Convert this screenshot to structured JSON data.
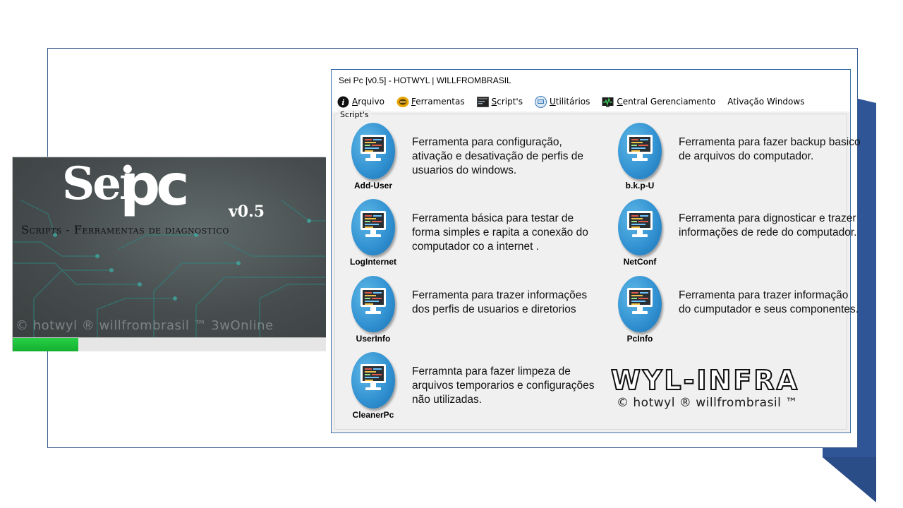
{
  "splash": {
    "logo_sei": "Sei",
    "logo_pc": "pc",
    "version": "v0.5",
    "subtitle": "Scripts - Ferramentas de diagnostico",
    "copyright": "© hotwyl ® willfrombrasil ™ 3wOnline",
    "progress": 0.21
  },
  "window": {
    "title": "Sei Pc [v0.5] - HOTWYL | WILLFROMBRASIL",
    "menu": [
      {
        "label": "Arquivo",
        "icon": "info-icon"
      },
      {
        "label": "Ferramentas",
        "icon": "tools-icon"
      },
      {
        "label": "Script's",
        "icon": "terminal-icon"
      },
      {
        "label": "Utilitários",
        "icon": "utility-icon"
      },
      {
        "label": "Central Gerenciamento",
        "icon": "monitor-icon"
      },
      {
        "label": "Ativação Windows",
        "icon": ""
      }
    ],
    "group_label": "Script's"
  },
  "tools": [
    {
      "name": "Add-User",
      "desc": "Ferramenta para configuração, ativação e desativação de perfis de usuarios do windows."
    },
    {
      "name": "b.k.p-U",
      "desc": "Ferramenta para fazer backup basico de arquivos do computador."
    },
    {
      "name": "LogInternet",
      "desc": "Ferramenta básica para testar de forma simples e rapita a conexão do computador co a internet ."
    },
    {
      "name": "NetConf",
      "desc": "Ferramenta para dignosticar e trazer informações de rede do computador."
    },
    {
      "name": "UserInfo",
      "desc": "Ferramenta para trazer informações dos perfis de usuarios e diretorios"
    },
    {
      "name": "PcInfo",
      "desc": "Ferramenta para trazer informação do cumputador e seus componentes."
    },
    {
      "name": "CleanerPc",
      "desc": "Ferramnta para fazer limpeza de arquivos temporarios e configurações não utilizadas."
    }
  ],
  "brand": {
    "title": "WYL-INFRA",
    "copyright": "© hotwyl ® willfrombrasil ™"
  },
  "colors": {
    "frame": "#3b5f8f",
    "deco_shape": "#2f5597",
    "progress": "#1fbf3a",
    "icon_blue": "#2f8fd0"
  }
}
